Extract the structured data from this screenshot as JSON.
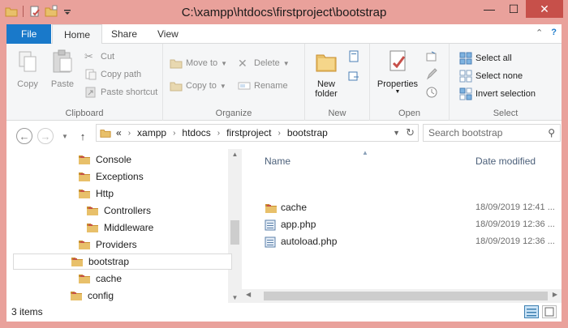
{
  "window": {
    "title": "C:\\xampp\\htdocs\\firstproject\\bootstrap"
  },
  "ribbon_tabs": {
    "file": "File",
    "home": "Home",
    "share": "Share",
    "view": "View"
  },
  "clipboard": {
    "label": "Clipboard",
    "copy": "Copy",
    "paste": "Paste",
    "cut": "Cut",
    "copy_path": "Copy path",
    "paste_shortcut": "Paste shortcut"
  },
  "organize": {
    "label": "Organize",
    "move_to": "Move to",
    "copy_to": "Copy to",
    "delete": "Delete",
    "rename": "Rename"
  },
  "new": {
    "label": "New",
    "new_folder_line1": "New",
    "new_folder_line2": "folder"
  },
  "open": {
    "label": "Open",
    "properties": "Properties"
  },
  "select": {
    "label": "Select",
    "select_all": "Select all",
    "select_none": "Select none",
    "invert": "Invert selection"
  },
  "address": {
    "overflow": "«",
    "crumbs": [
      "xampp",
      "htdocs",
      "firstproject",
      "bootstrap"
    ]
  },
  "search": {
    "placeholder": "Search bootstrap"
  },
  "nav": {
    "items": [
      {
        "label": "Console",
        "level": 2
      },
      {
        "label": "Exceptions",
        "level": 2
      },
      {
        "label": "Http",
        "level": 2
      },
      {
        "label": "Controllers",
        "level": 3
      },
      {
        "label": "Middleware",
        "level": 3
      },
      {
        "label": "Providers",
        "level": 2
      },
      {
        "label": "bootstrap",
        "level": 1,
        "selected": true
      },
      {
        "label": "cache",
        "level": 2
      },
      {
        "label": "config",
        "level": 1
      }
    ]
  },
  "files": {
    "col_name": "Name",
    "col_date": "Date modified",
    "rows": [
      {
        "name": "cache",
        "date": "18/09/2019 12:41 ...",
        "kind": "folder"
      },
      {
        "name": "app.php",
        "date": "18/09/2019 12:36 ...",
        "kind": "php"
      },
      {
        "name": "autoload.php",
        "date": "18/09/2019 12:36 ...",
        "kind": "php"
      }
    ]
  },
  "status": {
    "count": "3 items"
  },
  "colors": {
    "frame": "#e9a19b",
    "accent": "#1979ca",
    "folder": "#e8c06a",
    "folder_dark": "#c98f2e"
  }
}
